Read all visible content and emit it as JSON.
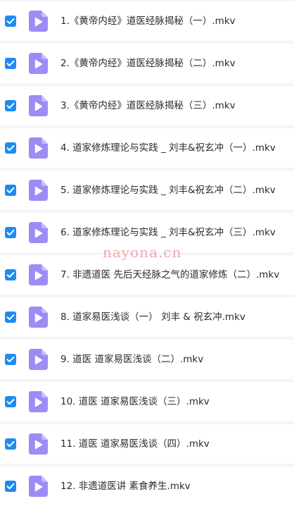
{
  "colors": {
    "page_background": "#f5f5f7",
    "row_background": "#ffffff",
    "checkbox_fill": "#1e8bf3",
    "file_icon_fill": "#9c8cf5",
    "text": "#2b2b2b",
    "watermark": "#e98c8c"
  },
  "watermark": "nayona.cn",
  "files": [
    {
      "name": "1.《黄帝内经》道医经脉揭秘（一）.mkv",
      "checked": true,
      "icon": "video-file-icon"
    },
    {
      "name": "2.《黄帝内经》道医经脉揭秘（二）.mkv",
      "checked": true,
      "icon": "video-file-icon"
    },
    {
      "name": "3.《黄帝内经》道医经脉揭秘（三）.mkv",
      "checked": true,
      "icon": "video-file-icon"
    },
    {
      "name": "4. 道家修炼理论与实践 _ 刘丰&祝玄冲（一）.mkv",
      "checked": true,
      "icon": "video-file-icon"
    },
    {
      "name": "5. 道家修炼理论与实践 _ 刘丰&祝玄冲（二）.mkv",
      "checked": true,
      "icon": "video-file-icon"
    },
    {
      "name": "6. 道家修炼理论与实践 _ 刘丰&祝玄冲（三）.mkv",
      "checked": true,
      "icon": "video-file-icon"
    },
    {
      "name": "7. 非遗道医 先后天经脉之气的道家修炼（二）.mkv",
      "checked": true,
      "icon": "video-file-icon"
    },
    {
      "name": "8. 道家易医浅谈（一） 刘丰 & 祝玄冲.mkv",
      "checked": true,
      "icon": "video-file-icon"
    },
    {
      "name": "9. 道医 道家易医浅谈（二）.mkv",
      "checked": true,
      "icon": "video-file-icon"
    },
    {
      "name": "10. 道医 道家易医浅谈（三）.mkv",
      "checked": true,
      "icon": "video-file-icon"
    },
    {
      "name": "11. 道医 道家易医浅谈（四）.mkv",
      "checked": true,
      "icon": "video-file-icon"
    },
    {
      "name": "12. 非遗道医讲 素食养生.mkv",
      "checked": true,
      "icon": "video-file-icon"
    }
  ]
}
